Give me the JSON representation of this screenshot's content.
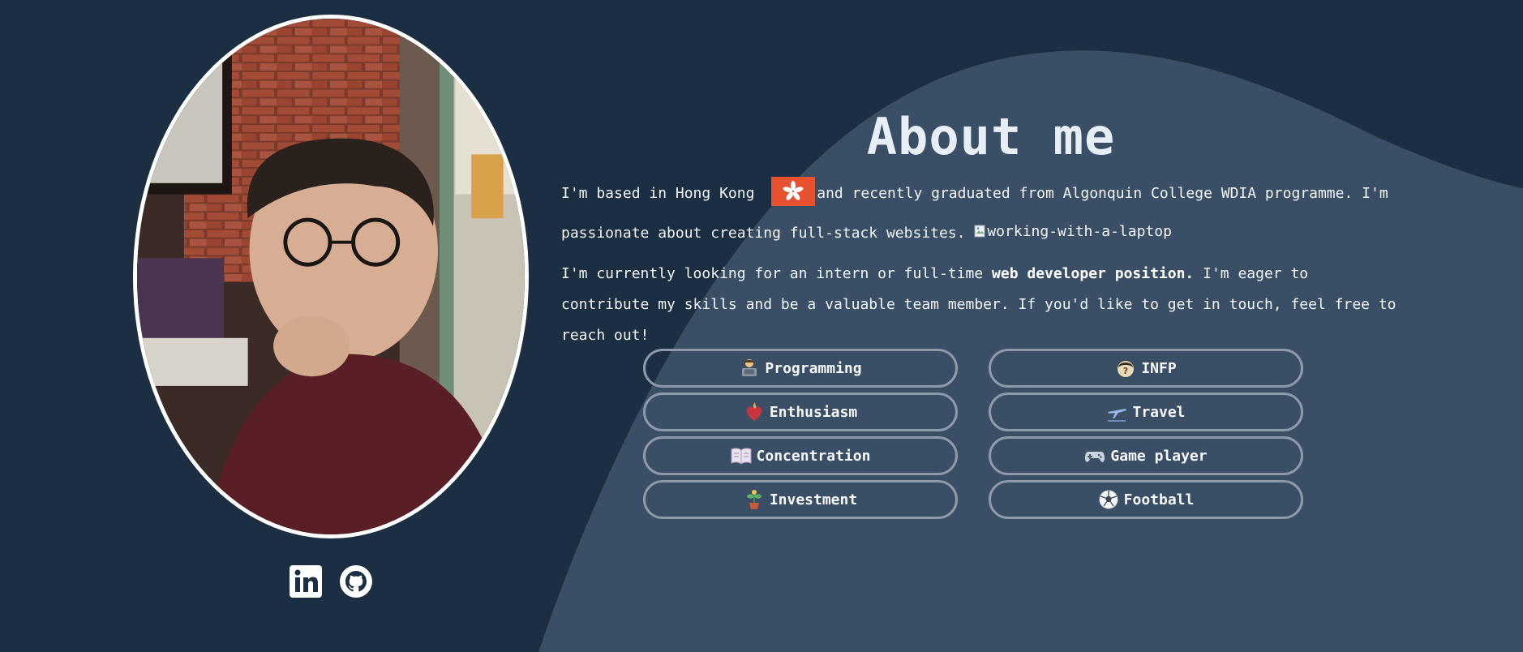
{
  "about": {
    "title": "About me",
    "para1_part1": "I'm based in Hong Kong ",
    "para1_part2": "and recently graduated from Algonquin College WDIA programme. I'm passionate about creating full-stack websites. ",
    "laptop_alt": "working-with-a-laptop",
    "para2_part1": "I'm currently looking for an intern or full-time ",
    "para2_bold": "web developer position.",
    "para2_part2": " I'm eager to contribute my skills and be a valuable team member. If you'd like to get in touch, feel free to reach out!"
  },
  "traits": [
    {
      "label": "Programming",
      "icon": "technologist-icon"
    },
    {
      "label": "INFP",
      "icon": "thinking-person-icon"
    },
    {
      "label": "Enthusiasm",
      "icon": "burning-heart-icon"
    },
    {
      "label": "Travel",
      "icon": "airplane-icon"
    },
    {
      "label": "Concentration",
      "icon": "open-book-icon"
    },
    {
      "label": "Game player",
      "icon": "gamepad-icon"
    },
    {
      "label": "Investment",
      "icon": "money-plant-icon"
    },
    {
      "label": "Football",
      "icon": "soccer-ball-icon"
    }
  ],
  "colors": {
    "background": "#1c2e41",
    "blob": "#3a4f66",
    "pill_border": "#8e9aab",
    "flag_red": "#e8512f"
  }
}
